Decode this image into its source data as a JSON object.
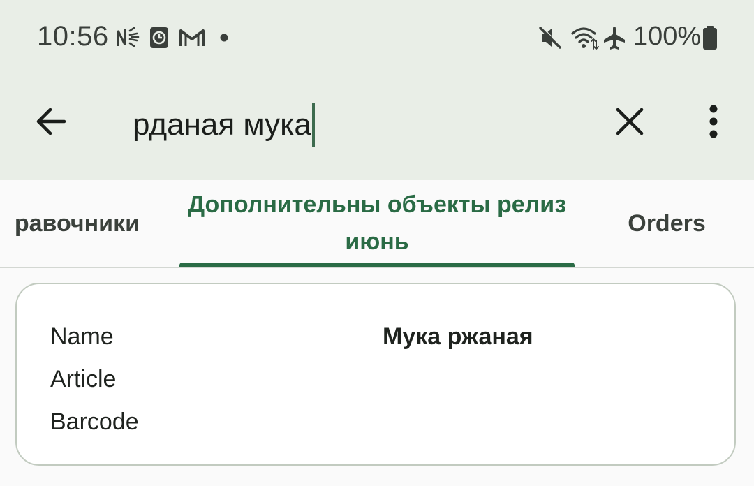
{
  "status_bar": {
    "time": "10:56",
    "battery_percent": "100%",
    "left_icons": [
      "nfc-icon",
      "clock-notification-icon",
      "gmail-icon",
      "more-notifications-dot-icon"
    ],
    "right_icons": [
      "mute-icon",
      "wifi-icon",
      "airplane-mode-icon",
      "battery-icon"
    ]
  },
  "app_bar": {
    "back_icon": "arrow-back-icon",
    "search_value": "рданая мука",
    "clear_icon": "close-icon",
    "more_icon": "more-vert-icon"
  },
  "tabs": [
    {
      "label": "равочники",
      "active": false
    },
    {
      "label": "Дополнительны объекты релиз июнь",
      "active": true
    },
    {
      "label": "Orders",
      "active": false
    }
  ],
  "result_card": {
    "fields": [
      {
        "label": "Name",
        "value": "Мука ржаная"
      },
      {
        "label": "Article",
        "value": ""
      },
      {
        "label": "Barcode",
        "value": ""
      }
    ]
  },
  "colors": {
    "top_background": "#e9eee7",
    "accent_green": "#2a6b45",
    "card_border": "#c2cbc0"
  }
}
